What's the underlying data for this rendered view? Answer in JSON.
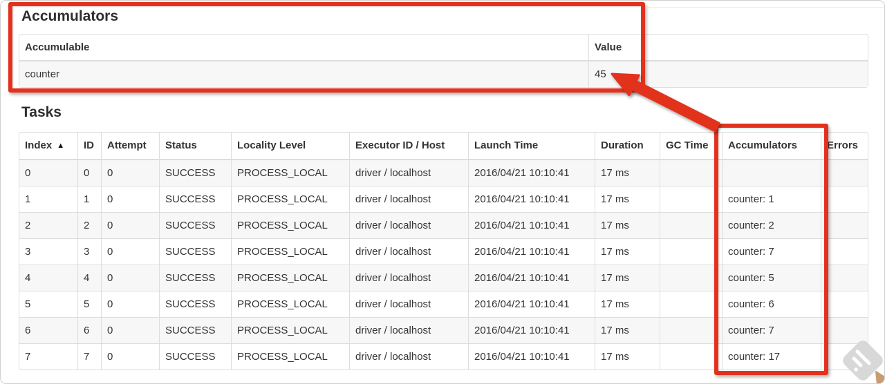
{
  "sections": {
    "accumulators_heading": "Accumulators",
    "tasks_heading": "Tasks"
  },
  "accumulators_table": {
    "headers": [
      "Accumulable",
      "Value"
    ],
    "rows": [
      [
        "counter",
        "45"
      ]
    ]
  },
  "tasks_table": {
    "headers": [
      "Index",
      "ID",
      "Attempt",
      "Status",
      "Locality Level",
      "Executor ID / Host",
      "Launch Time",
      "Duration",
      "GC Time",
      "Accumulators",
      "Errors"
    ],
    "sorted_column": "Index",
    "sort_icon": "▲",
    "rows": [
      [
        "0",
        "0",
        "0",
        "SUCCESS",
        "PROCESS_LOCAL",
        "driver / localhost",
        "2016/04/21 10:10:41",
        "17 ms",
        "",
        "",
        ""
      ],
      [
        "1",
        "1",
        "0",
        "SUCCESS",
        "PROCESS_LOCAL",
        "driver / localhost",
        "2016/04/21 10:10:41",
        "17 ms",
        "",
        "counter: 1",
        ""
      ],
      [
        "2",
        "2",
        "0",
        "SUCCESS",
        "PROCESS_LOCAL",
        "driver / localhost",
        "2016/04/21 10:10:41",
        "17 ms",
        "",
        "counter: 2",
        ""
      ],
      [
        "3",
        "3",
        "0",
        "SUCCESS",
        "PROCESS_LOCAL",
        "driver / localhost",
        "2016/04/21 10:10:41",
        "17 ms",
        "",
        "counter: 7",
        ""
      ],
      [
        "4",
        "4",
        "0",
        "SUCCESS",
        "PROCESS_LOCAL",
        "driver / localhost",
        "2016/04/21 10:10:41",
        "17 ms",
        "",
        "counter: 5",
        ""
      ],
      [
        "5",
        "5",
        "0",
        "SUCCESS",
        "PROCESS_LOCAL",
        "driver / localhost",
        "2016/04/21 10:10:41",
        "17 ms",
        "",
        "counter: 6",
        ""
      ],
      [
        "6",
        "6",
        "0",
        "SUCCESS",
        "PROCESS_LOCAL",
        "driver / localhost",
        "2016/04/21 10:10:41",
        "17 ms",
        "",
        "counter: 7",
        ""
      ],
      [
        "7",
        "7",
        "0",
        "SUCCESS",
        "PROCESS_LOCAL",
        "driver / localhost",
        "2016/04/21 10:10:41",
        "17 ms",
        "",
        "counter: 17",
        ""
      ]
    ]
  },
  "annotations": {
    "accent_color": "#e2321e",
    "watermark_color": "#d8d8d8",
    "corner_fragment_color": "#c89c73"
  }
}
